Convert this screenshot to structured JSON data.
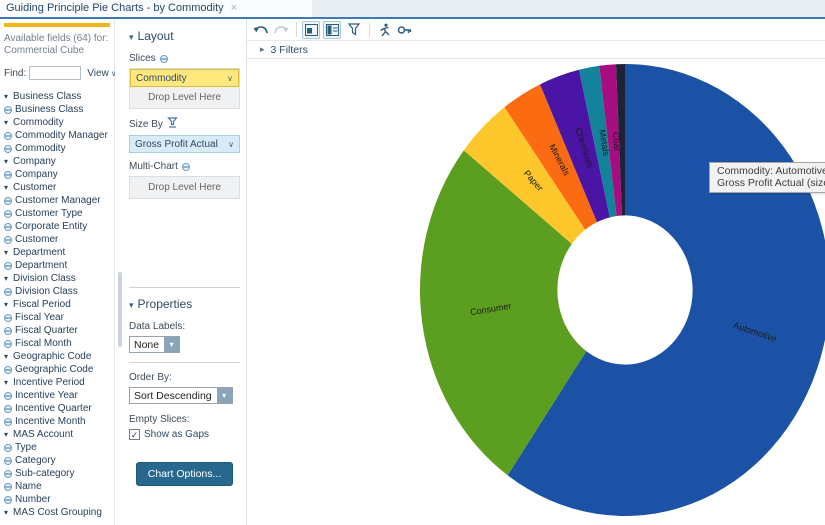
{
  "tab_bar": {
    "title": "Guiding Principle Pie Charts - by Commodity",
    "close_glyph": "×"
  },
  "sidebar": {
    "header_line1": "Available fields (64) for:",
    "header_line2": "Commercial Cube",
    "find_label": "Find:",
    "find_value": "",
    "view_label": "View",
    "tree": [
      {
        "type": "group",
        "label": "Business Class"
      },
      {
        "type": "field",
        "label": "Business Class"
      },
      {
        "type": "group",
        "label": "Commodity"
      },
      {
        "type": "field",
        "label": "Commodity Manager"
      },
      {
        "type": "field",
        "label": "Commodity"
      },
      {
        "type": "group",
        "label": "Company"
      },
      {
        "type": "field",
        "label": "Company"
      },
      {
        "type": "group",
        "label": "Customer"
      },
      {
        "type": "field",
        "label": "Customer Manager"
      },
      {
        "type": "field",
        "label": "Customer Type"
      },
      {
        "type": "field",
        "label": "Corporate Entity"
      },
      {
        "type": "field",
        "label": "Customer"
      },
      {
        "type": "group",
        "label": "Department"
      },
      {
        "type": "field",
        "label": "Department"
      },
      {
        "type": "group",
        "label": "Division Class"
      },
      {
        "type": "field",
        "label": "Division Class"
      },
      {
        "type": "group",
        "label": "Fiscal Period"
      },
      {
        "type": "field",
        "label": "Fiscal Year"
      },
      {
        "type": "field",
        "label": "Fiscal Quarter"
      },
      {
        "type": "field",
        "label": "Fiscal Month"
      },
      {
        "type": "group",
        "label": "Geographic Code"
      },
      {
        "type": "field",
        "label": "Geographic Code"
      },
      {
        "type": "group",
        "label": "Incentive Period"
      },
      {
        "type": "field",
        "label": "Incentive Year"
      },
      {
        "type": "field",
        "label": "Incentive Quarter"
      },
      {
        "type": "field",
        "label": "Incentive Month"
      },
      {
        "type": "group",
        "label": "MAS Account"
      },
      {
        "type": "field",
        "label": "Type"
      },
      {
        "type": "field",
        "label": "Category"
      },
      {
        "type": "field",
        "label": "Sub-category"
      },
      {
        "type": "field",
        "label": "Name"
      },
      {
        "type": "field",
        "label": "Number"
      },
      {
        "type": "group",
        "label": "MAS Cost Grouping"
      }
    ]
  },
  "layout_panel": {
    "layout_title": "Layout",
    "slices_label": "Slices",
    "slices_value": "Commodity",
    "drop_level": "Drop Level Here",
    "size_by_label": "Size By",
    "size_by_value": "Gross Profit Actual",
    "multi_chart_label": "Multi-Chart",
    "properties_title": "Properties",
    "data_labels_label": "Data Labels:",
    "data_labels_value": "None",
    "order_by_label": "Order By:",
    "order_by_value": "Sort Descending",
    "empty_slices_label": "Empty Slices:",
    "empty_slices_checkbox": "Show as Gaps",
    "checkbox_glyph": "✓",
    "chart_options_button": "Chart Options..."
  },
  "chart_panel": {
    "filters_label": "3 Filters",
    "tooltip_line1": "Commodity: Automotive",
    "tooltip_line2": "Gross Profit Actual (size): $10,258,"
  },
  "chart_data": {
    "type": "pie",
    "donut": true,
    "slices_dimension": "Commodity",
    "size_by_measure": "Gross Profit Actual",
    "order": "Sort Descending",
    "start_angle_deg": 0,
    "labels_on_slices": true,
    "tooltip_shown_for": "Automotive",
    "tooltip_value_visible": "$10,258, (truncated at screen edge)",
    "slices": [
      {
        "label": "Automotive",
        "percent": 59.7,
        "color": "#1b52a6"
      },
      {
        "label": "Consumer",
        "percent": 25.9,
        "color": "#5c9e1f"
      },
      {
        "label": "Paper",
        "percent": 4.4,
        "color": "#fdc62a"
      },
      {
        "label": "Minerals",
        "percent": 3.2,
        "color": "#fa6b12"
      },
      {
        "label": "Chemicals",
        "percent": 3.2,
        "color": "#4a14a5"
      },
      {
        "label": "Metals",
        "percent": 1.6,
        "color": "#12839b"
      },
      {
        "label": "Coal",
        "percent": 1.3,
        "color": "#a50d81"
      },
      {
        "label": "",
        "percent": 0.7,
        "color": "#1c2433"
      }
    ]
  }
}
